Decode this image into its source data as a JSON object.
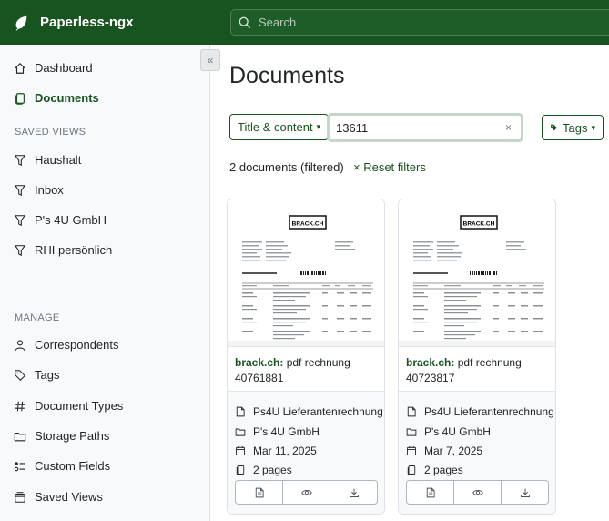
{
  "app": {
    "title": "Paperless-ngx"
  },
  "search": {
    "placeholder": "Search"
  },
  "sidebar": {
    "items": [
      {
        "label": "Dashboard",
        "icon": "house-icon"
      },
      {
        "label": "Documents",
        "icon": "files-icon",
        "active": true
      }
    ],
    "saved_views_title": "SAVED VIEWS",
    "saved_views": [
      {
        "label": "Haushalt",
        "icon": "funnel-icon"
      },
      {
        "label": "Inbox",
        "icon": "funnel-icon"
      },
      {
        "label": "P's 4U GmbH",
        "icon": "funnel-icon"
      },
      {
        "label": "RHI persönlich",
        "icon": "funnel-icon"
      }
    ],
    "manage_title": "MANAGE",
    "manage": [
      {
        "label": "Correspondents",
        "icon": "person-icon"
      },
      {
        "label": "Tags",
        "icon": "tags-icon"
      },
      {
        "label": "Document Types",
        "icon": "hash-icon"
      },
      {
        "label": "Storage Paths",
        "icon": "folder-icon"
      },
      {
        "label": "Custom Fields",
        "icon": "ui-radios-icon"
      },
      {
        "label": "Saved Views",
        "icon": "window-stack-icon"
      }
    ]
  },
  "main": {
    "title": "Documents",
    "filter_type": "Title & content",
    "filter_value": "13611",
    "clear_symbol": "×",
    "tags_label": "Tags",
    "doc_count": "2 documents (filtered)",
    "reset_label": "× Reset filters"
  },
  "documents": [
    {
      "correspondent": "brack.ch:",
      "title": "pdf rechnung 40761881",
      "doc_type": "Ps4U Lieferantenrechnung",
      "storage": "P's 4U GmbH",
      "date": "Mar 11, 2025",
      "pages": "2 pages",
      "thumb_logo": "BRACK.CH"
    },
    {
      "correspondent": "brack.ch:",
      "title": "pdf rechnung 40723817",
      "doc_type": "Ps4U Lieferantenrechnung",
      "storage": "P's 4U GmbH",
      "date": "Mar 7, 2025",
      "pages": "2 pages",
      "thumb_logo": "BRACK.CH"
    }
  ],
  "colors": {
    "brand": "#17541f",
    "header_bg": "#17541f",
    "sidebar_bg": "#f8f9fa"
  }
}
